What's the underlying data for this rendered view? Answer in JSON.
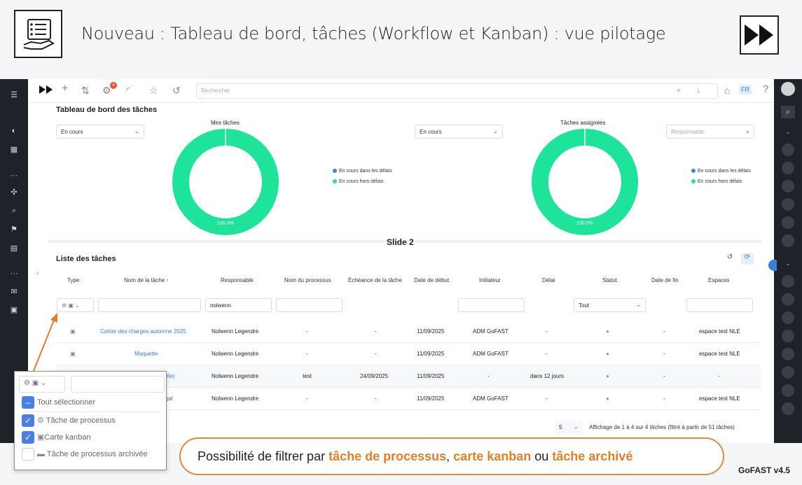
{
  "banner": {
    "title": "Nouveau : Tableau de bord, tâches (Workflow et Kanban) : vue pilotage",
    "logo_icon": "checklist-hand-icon",
    "ff_icon": "fast-forward-icon"
  },
  "topbar": {
    "search_placeholder": "Rechercher",
    "notif_count": "4",
    "lang": "FR",
    "help": "?"
  },
  "dashboard": {
    "title": "Tableau de bord des tâches",
    "left_chart": {
      "label": "Mes tâches",
      "filter": "En cours",
      "legend": [
        "En cours dans les délais",
        "En cours hors délais"
      ],
      "percent_label": "100.0%"
    },
    "right_chart": {
      "label": "Tâches assignées",
      "filter": "En cours",
      "responsable_placeholder": "Responsable",
      "legend": [
        "En cours dans les délais",
        "En cours hors délais"
      ],
      "percent_label": "100.0%"
    },
    "colors": {
      "in_time": "#3b82f6",
      "late": "#1ee39a"
    }
  },
  "slide_label": "Slide 2",
  "tasks": {
    "title": "Liste des tâches",
    "columns": [
      "Type",
      "Nom de la tâche",
      "Responsable",
      "Nom du processus",
      "Échéance de la tâche",
      "Date de début",
      "Initiateur",
      "Délai",
      "Statut",
      "Date de fin",
      "Espaces"
    ],
    "sort_arrow": "↑",
    "filters": {
      "responsable": "nolwenn",
      "statut": "Tout"
    },
    "rows": [
      {
        "name": "Cahier des charges automne 2025",
        "resp": "Nolwenn Legendre",
        "process": "-",
        "due": "-",
        "start": "11/09/2025",
        "initiator": "ADM GoFAST",
        "delay": "-",
        "end": "-",
        "space": "espace test NLE"
      },
      {
        "name": "Maquette",
        "resp": "Nolwenn Legendre",
        "process": "-",
        "due": "-",
        "start": "11/09/2025",
        "initiator": "ADM GoFAST",
        "delay": "-",
        "end": "-",
        "space": "espace test NLE"
      },
      {
        "name": "uelle)",
        "resp": "Nolwenn Legendre",
        "process": "test",
        "due": "24/09/2025",
        "start": "11/09/2025",
        "initiator": "-",
        "delay": "dans 12 jours",
        "end": "-",
        "space": "-"
      },
      {
        "name": "gal",
        "resp": "Nolwenn Legendre",
        "process": "-",
        "due": "-",
        "start": "11/09/2025",
        "initiator": "ADM GoFAST",
        "delay": "-",
        "end": "-",
        "space": "espace test NLE"
      }
    ],
    "page_size": "5",
    "pagination": "Affichage de 1 à 4 sur 4 tâches (filtré à partir de 51 tâches)"
  },
  "popup": {
    "select_all": "Tout sélectionner",
    "opt1": "Tâche de processus",
    "opt2": "Carte kanban",
    "opt3": "Tâche de processus archivée"
  },
  "callout": {
    "prefix": "Possibilité de filtrer par ",
    "h1": "tâche de processus",
    "sep1": ", ",
    "h2": "carte kanban",
    "sep2": " ou ",
    "h3": "tâche archivé"
  },
  "version": "GoFAST v4.5"
}
